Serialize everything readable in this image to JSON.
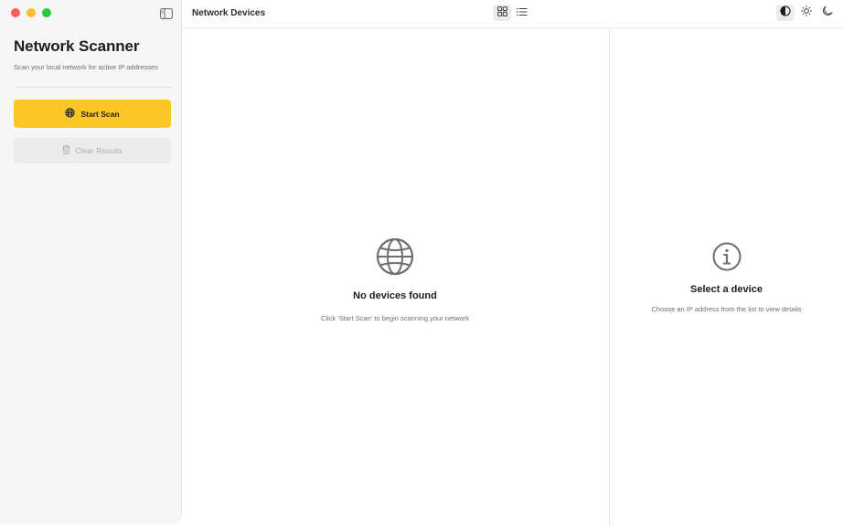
{
  "sidebar": {
    "title": "Network Scanner",
    "subtitle": "Scan your local network for active IP addresses",
    "start_scan_label": "Start Scan",
    "clear_results_label": "Clear Results"
  },
  "toolbar": {
    "title": "Network Devices",
    "view_modes": [
      "grid-icon",
      "list-icon"
    ],
    "appearance_modes": [
      "auto-appearance-icon",
      "sun-icon",
      "moon-icon"
    ]
  },
  "device_list": {
    "empty_title": "No devices found",
    "empty_subtitle": "Click 'Start Scan' to begin scanning your network"
  },
  "detail": {
    "empty_title": "Select a device",
    "empty_subtitle": "Choose an IP address from the list to view details"
  },
  "colors": {
    "accent": "#fdc627",
    "close": "#fe5f57",
    "minimize": "#febc2e",
    "maximize": "#28c840"
  }
}
